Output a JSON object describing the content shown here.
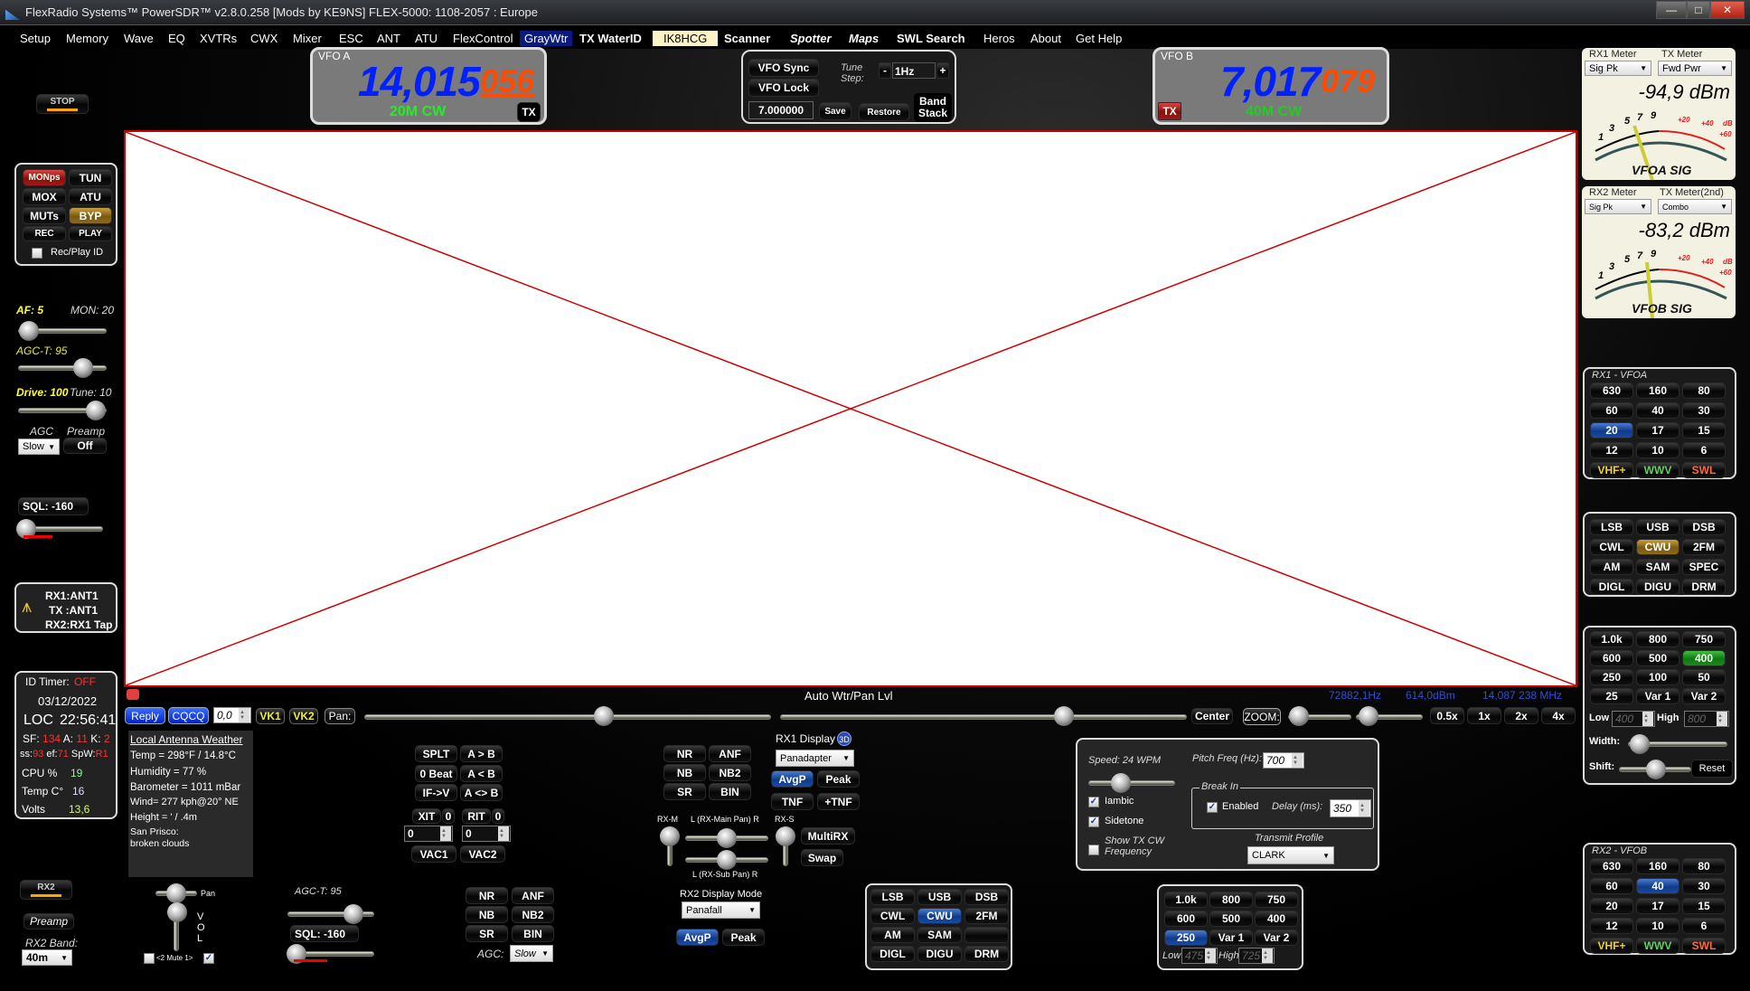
{
  "window": {
    "title": "FlexRadio Systems™  PowerSDR™  v2.8.0.258   [Mods by KE9NS]   FLEX-5000: 1108-2057 : Europe",
    "controls": {
      "minimize": "—",
      "maximize": "□",
      "close": "✕"
    }
  },
  "menu": {
    "items": [
      "Setup",
      "Memory",
      "Wave",
      "EQ",
      "XVTRs",
      "CWX",
      "Mixer",
      "ESC",
      "ANT",
      "ATU",
      "FlexControl",
      "GrayWtr",
      "TX WaterID",
      "IK8HCG",
      "Scanner",
      "Spotter",
      "Maps",
      "SWL Search",
      "Heros",
      "About",
      "Get Help"
    ]
  },
  "vfoA": {
    "label": "VFO A",
    "freq_main": "14,015",
    "freq_sub": "056",
    "mode": "20M CW",
    "tx": "TX"
  },
  "vfoB": {
    "label": "VFO B",
    "freq_main": "7,017",
    "freq_sub": "079",
    "mode": "40M CW",
    "tx": "TX"
  },
  "vfoCenter": {
    "sync": "VFO Sync",
    "lock": "VFO Lock",
    "tune_step_label": "Tune Step:",
    "step_minus": "-",
    "step_value": "1Hz",
    "step_plus": "+",
    "freq_entry": "7.000000",
    "save": "Save",
    "restore": "Restore",
    "band_stack": "Band Stack"
  },
  "left": {
    "stop": "STOP",
    "tx_buttons": [
      "MONps",
      "TUN",
      "MOX",
      "ATU",
      "MUTs",
      "BYP",
      "REC",
      "PLAY"
    ],
    "rec_play_id": "Rec/Play ID",
    "af": "AF: 5",
    "mon": "MON: 20",
    "af_level": 5,
    "mon_level": 20,
    "agct": "AGC-T:  95",
    "agct_level": 95,
    "drive": "Drive: 100",
    "tune": "Tune: 10",
    "drive_level": 100,
    "agc_label": "AGC",
    "preamp_label": "Preamp",
    "agc_value": "Slow",
    "preamp_value": "Off",
    "sql": "SQL: -160",
    "sql_level": -160,
    "antenna": {
      "rx1": "RX1:ANT1",
      "tx": "TX :ANT1",
      "rx2": "RX2:RX1 Tap"
    },
    "status": {
      "id_timer_label": "ID Timer:",
      "id_timer_value": "OFF",
      "date": "03/12/2022",
      "loc_label": "LOC",
      "time": "22:56:41",
      "sf_label": "SF:",
      "sf": "134",
      "a_label": "A:",
      "a": "11",
      "k_label": "K:",
      "k": "2",
      "ss_label": "ss:",
      "ss": "93",
      "ef_label": "ef:",
      "ef": "71",
      "spw_label": "SpW:",
      "spw": "R1",
      "cpu_label": "CPU %",
      "cpu": "19",
      "temp_label": "Temp C°",
      "temp": "16",
      "volts_label": "Volts",
      "volts": "13,6"
    },
    "rx2": "RX2",
    "rx2_preamp": "Preamp",
    "rx2_band_label": "RX2 Band:",
    "rx2_band": "40m"
  },
  "meters": {
    "rx1": {
      "label": "RX1 Meter",
      "tx_label": "TX Meter",
      "mode": "Sig Pk",
      "tx_mode": "Fwd Pwr",
      "value": "-94,9 dBm",
      "caption": "VFOA SIG"
    },
    "rx2": {
      "label": "RX2 Meter",
      "tx_label": "TX Meter(2nd)",
      "mode": "Sig Pk",
      "tx_mode": "Combo",
      "value": "-83,2 dBm",
      "caption": "VFOB SIG"
    },
    "scale": [
      "1",
      "3",
      "5",
      "7",
      "9",
      "+20",
      "+40",
      "dB",
      "+60"
    ]
  },
  "display": {
    "auto_label": "Auto Wtr/Pan Lvl",
    "readout_hz": "72882,1Hz",
    "readout_dbm": "614,0dBm",
    "readout_mhz": "14,087 238 MHz",
    "reply": "Reply",
    "cqcq": "CQCQ",
    "cq_value": "0,0",
    "vk1": "VK1",
    "vk2": "VK2",
    "pan": "Pan:",
    "center": "Center",
    "zoom": "ZOOM:",
    "zoom_buttons": [
      "0.5x",
      "1x",
      "2x",
      "4x"
    ]
  },
  "weather": {
    "title": "Local Antenna Weather",
    "lines": [
      "Temp = 298°F / 14.8°C",
      "Humidity = 77 %",
      "Barometer = 1011 mBar",
      "Wind= 277 kph@20° NE",
      "Height = ' / .4m",
      "San Prisco:",
      "broken clouds"
    ]
  },
  "vfoOps": {
    "buttons": [
      "SPLT",
      "A > B",
      "0 Beat",
      "A < B",
      "IF->V",
      "A <> B"
    ],
    "xit": "XIT",
    "xit_val": "0",
    "rit": "RIT",
    "rit_val": "0",
    "xit_entry": "0",
    "rit_entry": "0",
    "vac1": "VAC1",
    "vac2": "VAC2"
  },
  "dsp1": {
    "buttons": [
      "NR",
      "ANF",
      "NB",
      "NB2",
      "SR",
      "BIN"
    ]
  },
  "rx1display": {
    "label": "RX1 Display",
    "badge": "3D",
    "mode": "Panadapter",
    "avgp": "AvgP",
    "peak": "Peak",
    "tnf": "TNF",
    "ptnf": "+TNF"
  },
  "mixer": {
    "rxm": "RX-M",
    "rxs": "RX-S",
    "main_pan": "L (RX-Main Pan) R",
    "sub_pan": "L (RX-Sub Pan) R",
    "multirx": "MultiRX",
    "swap": "Swap"
  },
  "rx2display": {
    "label": "RX2 Display Mode",
    "mode": "Panafall",
    "avgp": "AvgP",
    "peak": "Peak"
  },
  "rx2panel": {
    "pan": "Pan",
    "vol": "V O L",
    "mute": "<2 Mute 1>",
    "agct": "AGC-T:  95",
    "sql": "SQL: -160",
    "dsp": [
      "NR",
      "ANF",
      "NB",
      "NB2",
      "SR",
      "BIN"
    ],
    "agc_label": "AGC:",
    "agc": "Slow"
  },
  "modes2": {
    "buttons": [
      "LSB",
      "USB",
      "DSB",
      "CWL",
      "CWU",
      "2FM",
      "AM",
      "SAM",
      "",
      "DIGL",
      "DIGU",
      "DRM"
    ],
    "active": "CWU"
  },
  "cw": {
    "speed": "Speed:  24 WPM",
    "speed_wpm": 24,
    "pitch_label": "Pitch Freq (Hz):",
    "pitch": "700",
    "iambic": "Iambic",
    "sidetone": "Sidetone",
    "show_tx": "Show TX CW Frequency",
    "breakin": "Break In",
    "enabled": "Enabled",
    "delay_label": "Delay (ms):",
    "delay": "350",
    "profile_label": "Transmit Profile",
    "profile": "CLARK"
  },
  "filters2": {
    "buttons": [
      "1.0k",
      "800",
      "750",
      "600",
      "500",
      "400",
      "250",
      "Var 1",
      "Var 2"
    ],
    "active": "250",
    "low_label": "Low",
    "low": "475",
    "high_label": "High",
    "high": "725"
  },
  "bands1": {
    "title": "RX1 - VFOA",
    "buttons": [
      "630",
      "160",
      "80",
      "60",
      "40",
      "30",
      "20",
      "17",
      "15",
      "12",
      "10",
      "6",
      "VHF+",
      "WWV",
      "SWL"
    ],
    "active": "20"
  },
  "modes1": {
    "buttons": [
      "LSB",
      "USB",
      "DSB",
      "CWL",
      "CWU",
      "2FM",
      "AM",
      "SAM",
      "SPEC",
      "DIGL",
      "DIGU",
      "DRM"
    ],
    "active": "CWU"
  },
  "filters1": {
    "buttons": [
      "1.0k",
      "800",
      "750",
      "600",
      "500",
      "400",
      "250",
      "100",
      "50",
      "25",
      "Var 1",
      "Var 2"
    ],
    "active": "400",
    "low_label": "Low",
    "low": "400",
    "high_label": "High",
    "high": "800",
    "width": "Width:",
    "shift": "Shift:",
    "reset": "Reset"
  },
  "bands2": {
    "title": "RX2 - VFOB",
    "buttons": [
      "630",
      "160",
      "80",
      "60",
      "40",
      "30",
      "20",
      "17",
      "15",
      "12",
      "10",
      "6",
      "VHF+",
      "WWV",
      "SWL"
    ],
    "active": "40"
  },
  "colors": {
    "accent_blue": "#0020ff",
    "accent_orange": "#ff4a00",
    "mode_green": "#22ee22",
    "warn_red": "#ff3030"
  }
}
